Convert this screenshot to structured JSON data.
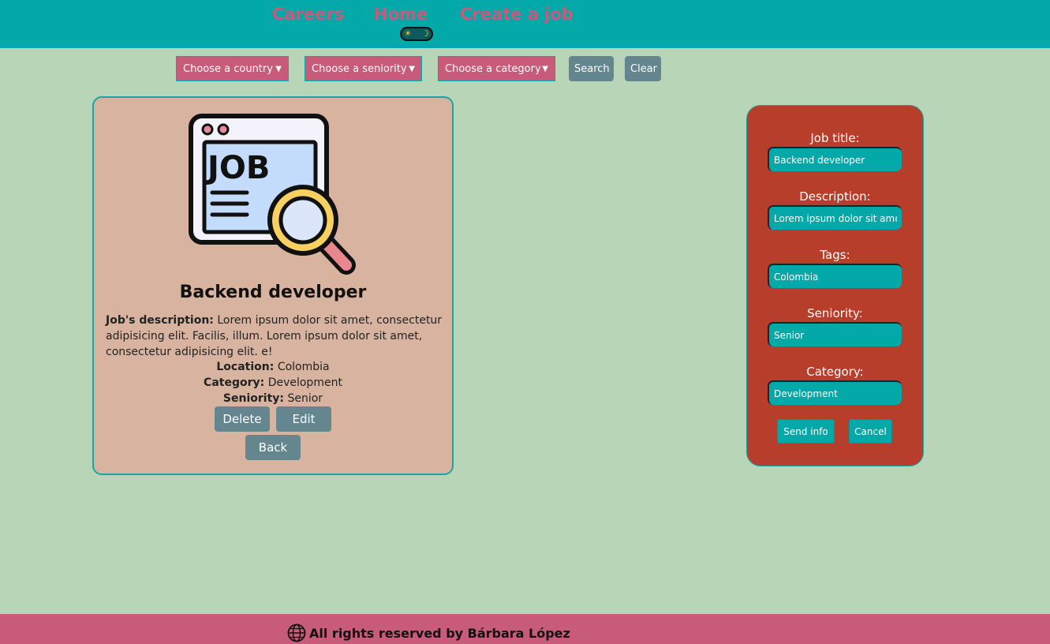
{
  "nav": {
    "careers": "Careers",
    "home": "Home",
    "create_job": "Create a job",
    "theme_toggle": {
      "sun_icon": "☀",
      "moon_icon": "☽"
    }
  },
  "filters": {
    "country": "Choose a country",
    "seniority": "Choose a seniority",
    "category": "Choose a category",
    "search_label": "Search",
    "clear_label": "Clear"
  },
  "job": {
    "title": "Backend developer",
    "description_label": "Job's description:",
    "description": "Lorem ipsum dolor sit amet, consectetur adipisicing elit. Facilis, illum. Lorem ipsum dolor sit amet, consectetur adipisicing elit. e!",
    "location_label": "Location:",
    "location": "Colombia",
    "category_label": "Category:",
    "category": "Development",
    "seniority_label": "Seniority:",
    "seniority": "Senior",
    "delete_label": "Delete",
    "edit_label": "Edit",
    "back_label": "Back",
    "illustration_text": "JOB"
  },
  "form": {
    "title_label": "Job title:",
    "title_value": "Backend developer",
    "description_label": "Description:",
    "description_value": "Lorem ipsum dolor sit amet",
    "tags_label": "Tags:",
    "tags_value": "Colombia",
    "seniority_label": "Seniority:",
    "seniority_value": "Senior",
    "category_label": "Category:",
    "category_value": "Development",
    "send_label": "Send info",
    "cancel_label": "Cancel"
  },
  "footer": {
    "text": "All rights reserved by Bárbara López"
  },
  "colors": {
    "header_bg": "#03a8a8",
    "page_bg": "#b8d6b7",
    "accent_pink": "#c85a7a",
    "card_bg": "#d8b4a0",
    "form_bg": "#b83e2c",
    "button_gray": "#64868f"
  }
}
